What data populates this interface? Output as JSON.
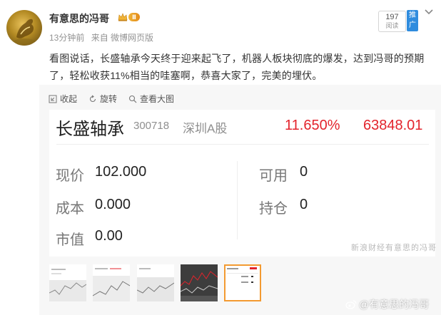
{
  "header": {
    "username": "有意思的冯哥",
    "vip_level": "Ⅱ",
    "time": "13分钟前",
    "source": "来自 微博网页版",
    "views_count": "197",
    "views_label": "阅读",
    "promo_label": "推广"
  },
  "post": {
    "text": "看图说话，长盛轴承今天终于迎来起飞了，机器人板块彻底的爆发，达到冯哥的预期了，轻松收获11%相当的哇塞啊，恭喜大家了，完美的埋伏。"
  },
  "toolbar": {
    "collapse_label": "收起",
    "rotate_label": "旋转",
    "view_large_label": "查看大图"
  },
  "stock_card": {
    "name": "长盛轴承",
    "code": "300718",
    "market": "深圳A股",
    "change_pct": "11.650%",
    "position_value": "63848.01",
    "price_label": "现价",
    "price_value": "102.000",
    "available_label": "可用",
    "available_value": "0",
    "cost_label": "成本",
    "cost_value": "0.000",
    "holding_label": "持仓",
    "holding_value": "0",
    "market_value_label": "市值",
    "market_value_value": "0.00",
    "watermark": "新浪财经有意思的冯哥"
  },
  "thumbnails": [
    {
      "id": "thumb-1"
    },
    {
      "id": "thumb-2"
    },
    {
      "id": "thumb-3"
    },
    {
      "id": "thumb-4"
    },
    {
      "id": "thumb-5",
      "mini_pct": "11.6",
      "mini_avail": "可用",
      "mini_hold": "持仓",
      "mini_val": "0"
    }
  ],
  "watermark": "@有意思的冯哥",
  "colors": {
    "accent_red": "#e3232c",
    "selected_border": "#f39a31",
    "promo_blue": "#2f8cde"
  }
}
